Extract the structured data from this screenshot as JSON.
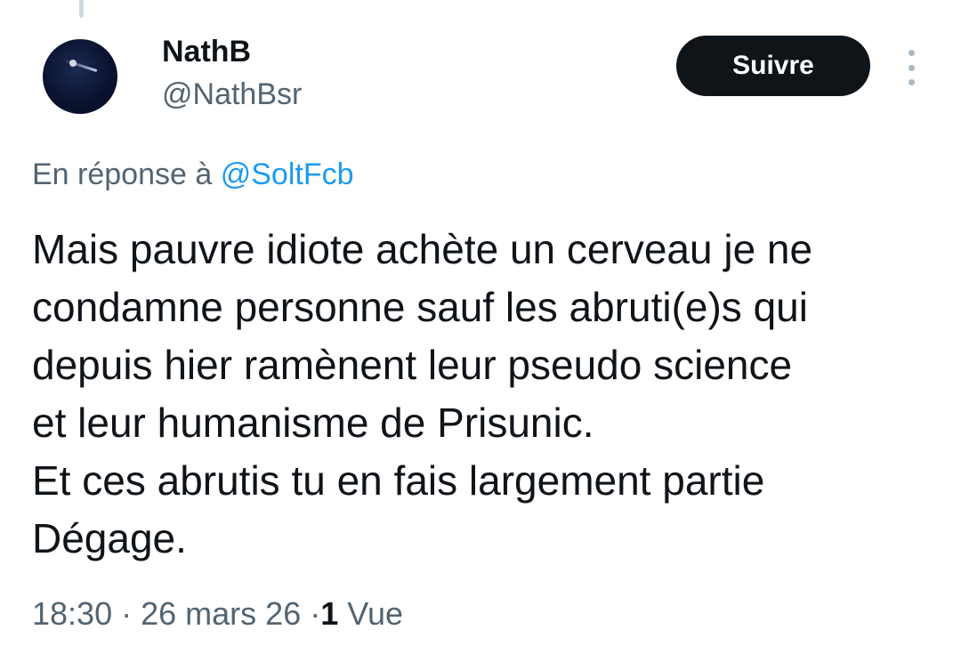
{
  "author": {
    "display_name": "NathB",
    "handle": "@NathBsr"
  },
  "follow_button": {
    "label": "Suivre"
  },
  "more_button": {
    "icon": "more-vertical-icon"
  },
  "reply": {
    "prefix": "En réponse à",
    "to_handle": "@SoltFcb"
  },
  "tweet": {
    "lines": [
      "Mais pauvre idiote achète un cerveau je ne",
      "condamne personne sauf les abruti(e)s qui",
      "depuis hier ramènent leur pseudo science",
      "et leur humanisme de Prisunic.",
      "Et ces abrutis tu en fais largement partie",
      "Dégage."
    ]
  },
  "meta": {
    "time": "18:30",
    "separator": "·",
    "date": "26 mars 26",
    "view_count": "1",
    "view_label": "Vue"
  },
  "colors": {
    "accent": "#1d9bf0",
    "text_primary": "#0f1419",
    "text_secondary": "#536471",
    "button_bg": "#0f1419"
  }
}
